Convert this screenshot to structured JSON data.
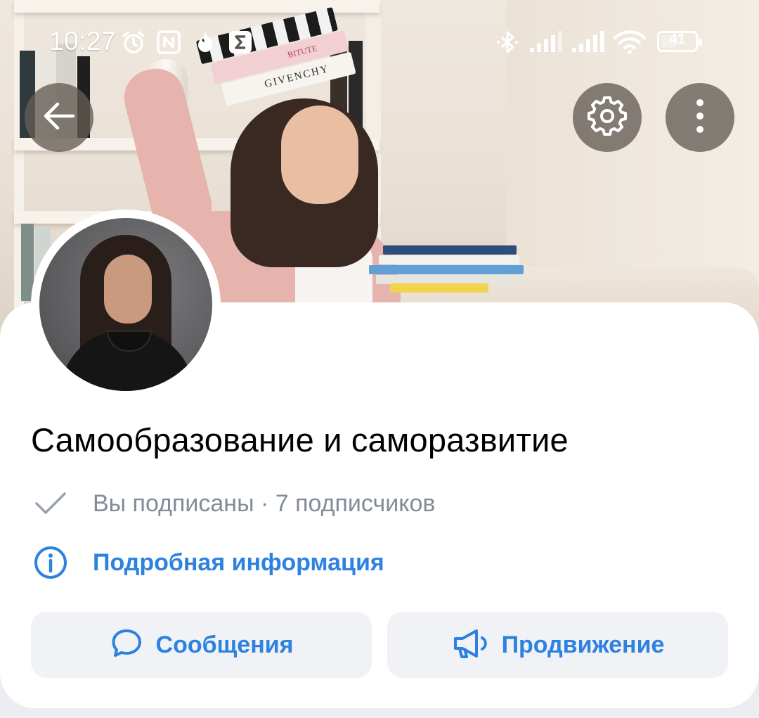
{
  "status_bar": {
    "time": "10:27",
    "battery": "41",
    "left_icons": [
      "alarm-icon",
      "nfc-icon",
      "fire-icon",
      "sigma-icon"
    ],
    "right_icons": [
      "bluetooth-icon",
      "signal-icon",
      "signal-icon",
      "wifi-icon",
      "battery-icon"
    ]
  },
  "cover": {
    "book_titles": [
      "GIVENCHY",
      "BITUTE"
    ]
  },
  "header_buttons": {
    "back": "arrow-left-icon",
    "settings": "gear-icon",
    "more": "more-vertical-icon"
  },
  "community": {
    "name": "Самообразование и саморазвитие",
    "subscription_status": "Вы подписаны · 7 подписчиков",
    "details_link": "Подробная информация"
  },
  "actions": {
    "messages": "Сообщения",
    "promotion": "Продвижение"
  },
  "colors": {
    "accent": "#2d81e0",
    "secondary_text": "#818c99",
    "button_bg": "#f0f2f5"
  }
}
